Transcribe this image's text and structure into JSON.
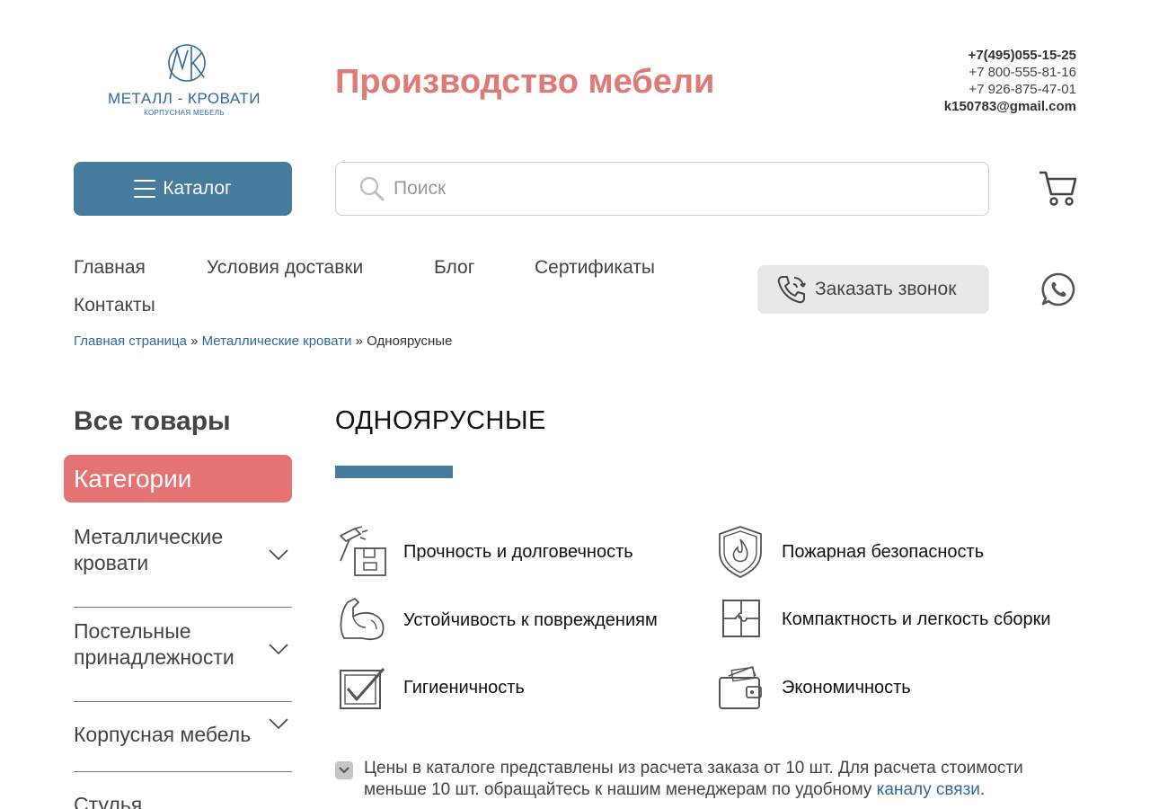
{
  "header": {
    "logo_name": "МЕТАЛЛ - КРОВАТИ",
    "logo_sub": "КОРПУСНАЯ МЕБЕЛЬ",
    "site_title": "Производство мебели",
    "phone_main": "+7(495)055-15-25",
    "phone_2": "+7 800-555-81-16",
    "phone_3": "+7 926-875-47-01",
    "email": "k150783@gmail.com"
  },
  "toolbar": {
    "catalog_label": "Каталог",
    "search_placeholder": "Поиск"
  },
  "nav": {
    "items": [
      "Главная",
      "Условия доставки",
      "Блог",
      "Сертификаты",
      "Контакты"
    ],
    "callback_label": "Заказать звонок"
  },
  "breadcrumb": {
    "home": "Главная страница",
    "sep": "»",
    "section": "Металлические кровати",
    "current": "Одноярусные"
  },
  "sidebar": {
    "all_goods": "Все товары",
    "categories": "Категории",
    "items": [
      "Металлические кровати",
      "Постельные принадлежности",
      "Корпусная мебель",
      "Стулья"
    ]
  },
  "main": {
    "title": "ОДНОЯРУСНЫЕ",
    "features": [
      {
        "label": "Прочность и долговечность",
        "icon": "hammer-box-icon"
      },
      {
        "label": "Пожарная безопасность",
        "icon": "fire-shield-icon"
      },
      {
        "label": "Устойчивость к повреждениям",
        "icon": "muscle-arm-icon"
      },
      {
        "label": "Компактность и легкость сборки",
        "icon": "puzzle-icon"
      },
      {
        "label": "Гигиеничность",
        "icon": "checkbox-icon"
      },
      {
        "label": "Экономичность",
        "icon": "wallet-icon"
      }
    ],
    "note_text": "Цены в каталоге представлены из расчета заказа от 10 шт. Для расчета стоимости меньше 10 шт. обращайтесь к нашим менеджерам по удобному",
    "note_link": "каналу связи",
    "note_end": "."
  },
  "colors": {
    "accent_blue": "#457b9d",
    "accent_red": "#e57373",
    "title_red": "#e07a74",
    "link_blue": "#2f6a9e"
  }
}
